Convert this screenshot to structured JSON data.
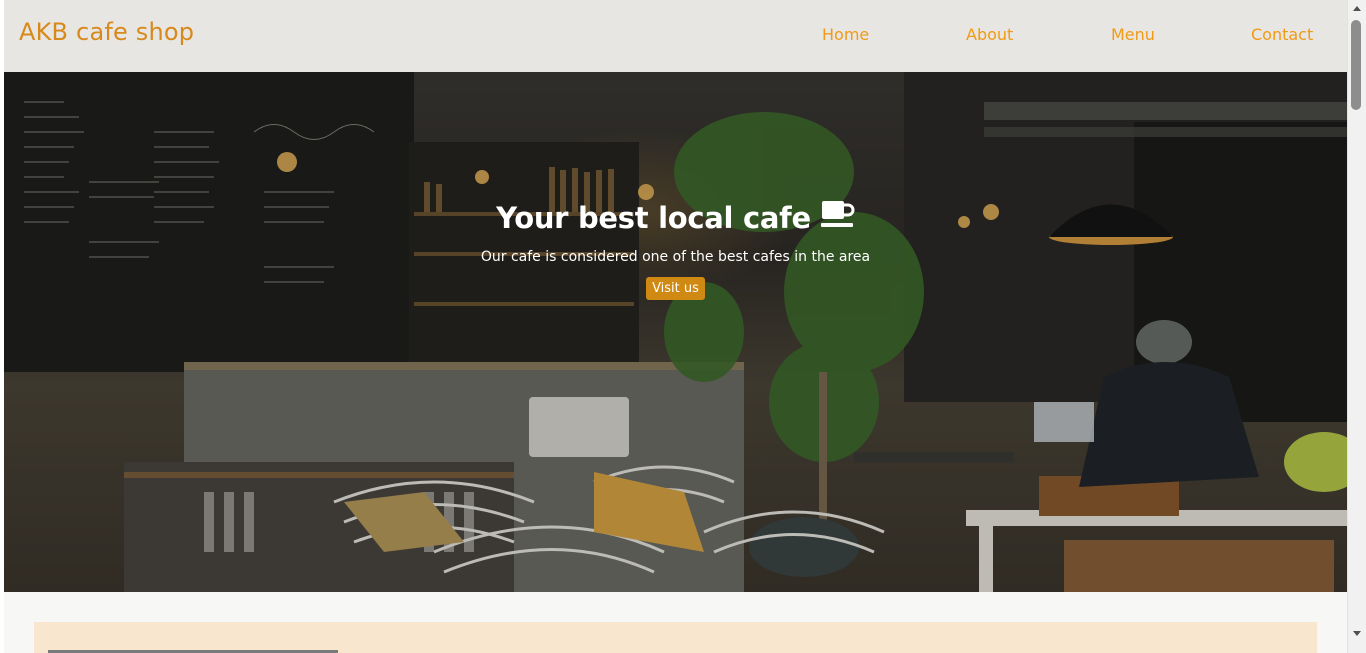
{
  "navbar": {
    "brand": "AKB cafe shop",
    "links": [
      "Home",
      "About",
      "Menu",
      "Contact"
    ]
  },
  "hero": {
    "title": "Your best local cafe",
    "title_icon": "coffee-cup-icon",
    "subtitle": "Our cafe is considered one of the best cafes in the area",
    "button_label": "Visit us"
  },
  "colors": {
    "brand": "#d8891b",
    "nav_link": "#f09a16",
    "button": "#d08913",
    "navbar_bg": "#e8e6e2",
    "panel": "#f8e6cf"
  }
}
